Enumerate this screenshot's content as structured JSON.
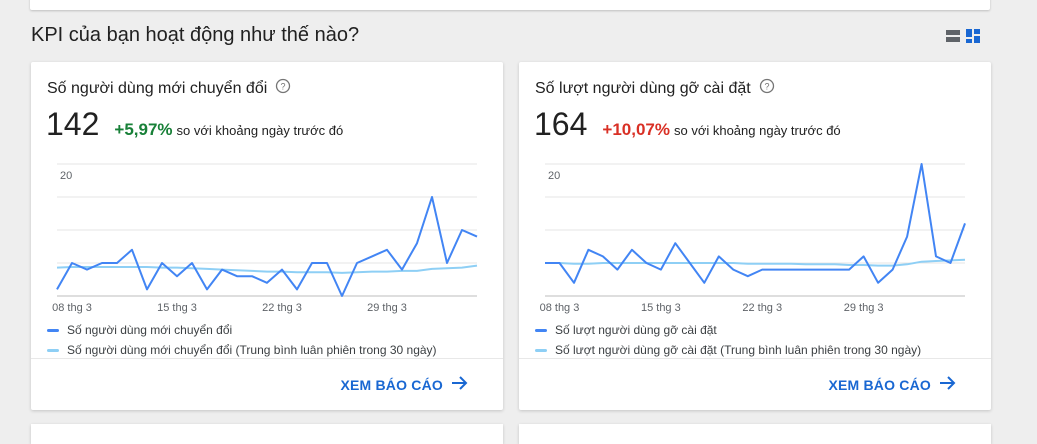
{
  "section": {
    "title": "KPI của bạn hoạt động như thế nào?",
    "view_icons": [
      "list-view-icon",
      "grid-view-icon"
    ]
  },
  "colors": {
    "series_primary": "#4285f4",
    "series_average": "#8ecff5",
    "positive_change": "#188038",
    "negative_change": "#d93025",
    "link": "#1967d2",
    "grid": "#e0e0e0"
  },
  "cards": [
    {
      "title": "Số người dùng mới chuyển đổi",
      "value": "142",
      "change": "+5,97%",
      "compare_text": "so với khoảng ngày trước đó",
      "legend_primary": "Số người dùng mới chuyển đổi",
      "legend_average": "Số người dùng mới chuyển đổi (Trung bình luân phiên trong 30 ngày)",
      "report_link": "XEM BÁO CÁO",
      "chart_data": {
        "type": "line",
        "x_ticks": [
          "08 thg 3",
          "15 thg 3",
          "22 thg 3",
          "29 thg 3"
        ],
        "y_ticks": [
          "20"
        ],
        "ylim": [
          0,
          20
        ],
        "grid": true,
        "x_start": 7,
        "series": [
          {
            "name": "Số người dùng mới chuyển đổi",
            "values": [
              1,
              5,
              4,
              5,
              5,
              7,
              1,
              5,
              3,
              5,
              1,
              4,
              3,
              3,
              2,
              4,
              1,
              5,
              5,
              0,
              5,
              6,
              7,
              4,
              8,
              15,
              5,
              10,
              9
            ]
          },
          {
            "name": "Số người dùng mới chuyển đổi (Trung bình luân phiên trong 30 ngày)",
            "values": [
              4.3,
              4.4,
              4.4,
              4.4,
              4.4,
              4.4,
              4.4,
              4.3,
              4.3,
              4.2,
              4.1,
              4.0,
              3.9,
              3.8,
              3.7,
              3.7,
              3.6,
              3.6,
              3.6,
              3.5,
              3.6,
              3.7,
              3.7,
              3.8,
              3.8,
              4.1,
              4.2,
              4.3,
              4.6
            ]
          }
        ]
      }
    },
    {
      "title": "Số lượt người dùng gỡ cài đặt",
      "value": "164",
      "change": "+10,07%",
      "compare_text": "so với khoảng ngày trước đó",
      "legend_primary": "Số lượt người dùng gỡ cài đặt",
      "legend_average": "Số lượt người dùng gỡ cài đặt (Trung bình luân phiên trong 30 ngày)",
      "report_link": "XEM BÁO CÁO",
      "chart_data": {
        "type": "line",
        "x_ticks": [
          "08 thg 3",
          "15 thg 3",
          "22 thg 3",
          "29 thg 3"
        ],
        "y_ticks": [
          "20"
        ],
        "ylim": [
          0,
          20
        ],
        "grid": true,
        "x_start": 7,
        "series": [
          {
            "name": "Số lượt người dùng gỡ cài đặt",
            "values": [
              5,
              5,
              2,
              7,
              6,
              4,
              7,
              5,
              4,
              8,
              5,
              2,
              6,
              4,
              3,
              4,
              4,
              4,
              4,
              4,
              4,
              4,
              6,
              2,
              4,
              9,
              20,
              6,
              5,
              11
            ]
          },
          {
            "name": "Số lượt người dùng gỡ cài đặt (Trung bình luân phiên trong 30 ngày)",
            "values": [
              5,
              5,
              4.9,
              4.9,
              5,
              5,
              5,
              5,
              5,
              5,
              5,
              5,
              5,
              5,
              4.9,
              4.9,
              4.9,
              4.9,
              4.8,
              4.8,
              4.8,
              4.7,
              4.7,
              4.6,
              4.6,
              4.8,
              5.2,
              5.3,
              5.4,
              5.5
            ]
          }
        ]
      }
    }
  ]
}
